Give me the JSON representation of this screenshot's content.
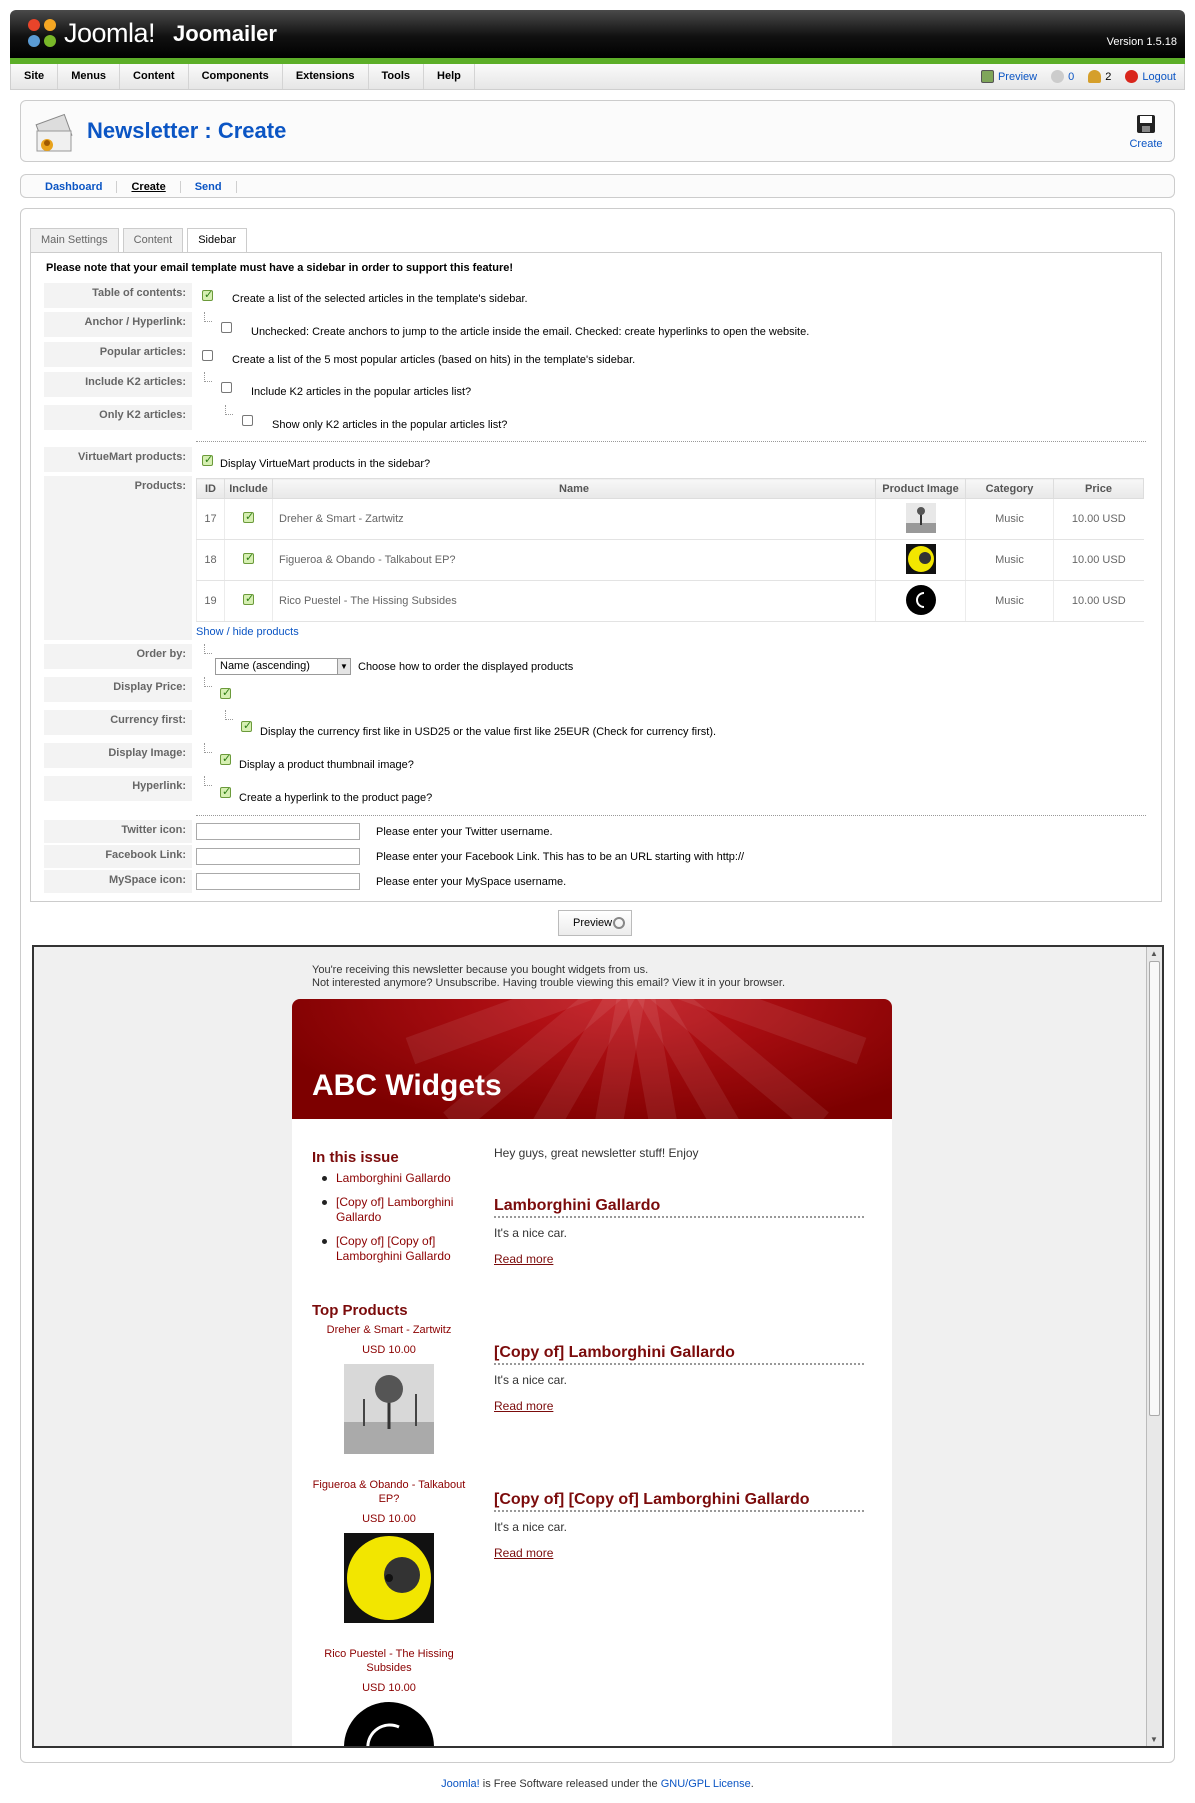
{
  "header": {
    "logo_text": "Joomla!",
    "app_title": "Joomailer",
    "version": "Version 1.5.18"
  },
  "menu": {
    "items": [
      "Site",
      "Menus",
      "Content",
      "Components",
      "Extensions",
      "Tools",
      "Help"
    ],
    "preview": "Preview",
    "messages_count": "0",
    "users_count": "2",
    "logout": "Logout"
  },
  "page": {
    "title": "Newsletter : Create",
    "create_label": "Create"
  },
  "submenu": [
    "Dashboard",
    "Create",
    "Send"
  ],
  "tabs": [
    "Main Settings",
    "Content",
    "Sidebar"
  ],
  "sidebar_form": {
    "notice": "Please note that your email template must have a sidebar in order to support this feature!",
    "toc_label": "Table of contents:",
    "toc_text": "Create a list of the selected articles in the template's sidebar.",
    "anchor_label": "Anchor / Hyperlink:",
    "anchor_text": "Unchecked: Create anchors to jump to the article inside the email. Checked: create hyperlinks to open the website.",
    "popular_label": "Popular articles:",
    "popular_text": "Create a list of the 5 most popular articles (based on hits) in the template's sidebar.",
    "k2_label": "Include K2 articles:",
    "k2_text": "Include K2 articles in the popular articles list?",
    "onlyk2_label": "Only K2 articles:",
    "onlyk2_text": "Show only K2 articles in the popular articles list?",
    "vm_label": "VirtueMart products:",
    "vm_text": "Display VirtueMart products in the sidebar?",
    "products_label": "Products:",
    "show_hide": "Show / hide products",
    "order_label": "Order by:",
    "order_value": "Name (ascending)",
    "order_text": "Choose how to order the displayed products",
    "price_label": "Display Price:",
    "currency_label": "Currency first:",
    "currency_text": "Display the currency first like in USD25 or the value first like 25EUR (Check for currency first).",
    "image_label": "Display Image:",
    "image_text": "Display a product thumbnail image?",
    "hyperlink_label": "Hyperlink:",
    "hyperlink_text": "Create a hyperlink to the product page?",
    "twitter_label": "Twitter icon:",
    "twitter_text": "Please enter your Twitter username.",
    "facebook_label": "Facebook Link:",
    "facebook_text": "Please enter your Facebook Link. This has to be an URL starting with http://",
    "myspace_label": "MySpace icon:",
    "myspace_text": "Please enter your MySpace username."
  },
  "products_table": {
    "headers": [
      "ID",
      "Include",
      "Name",
      "Product Image",
      "Category",
      "Price"
    ],
    "rows": [
      {
        "id": "17",
        "name": "Dreher & Smart - Zartwitz",
        "category": "Music",
        "price": "10.00 USD"
      },
      {
        "id": "18",
        "name": "Figueroa & Obando - Talkabout EP?",
        "category": "Music",
        "price": "10.00 USD"
      },
      {
        "id": "19",
        "name": "Rico Puestel - The Hissing Subsides",
        "category": "Music",
        "price": "10.00 USD"
      }
    ]
  },
  "preview_button": "Preview",
  "newsletter": {
    "top_line1": "You're receiving this newsletter because you bought widgets from us.",
    "top_line2": "Not interested anymore? Unsubscribe. Having trouble viewing this email? View it in your browser.",
    "brand": "ABC Widgets",
    "in_this_issue": "In this issue",
    "issue_items": [
      "Lamborghini Gallardo",
      "[Copy of] Lamborghini Gallardo",
      "[Copy of] [Copy of] Lamborghini Gallardo"
    ],
    "top_products": "Top Products",
    "products": [
      {
        "name": "Dreher & Smart - Zartwitz",
        "price": "USD 10.00"
      },
      {
        "name": "Figueroa & Obando - Talkabout EP?",
        "price": "USD 10.00"
      },
      {
        "name": "Rico Puestel - The Hissing Subsides",
        "price": "USD 10.00"
      }
    ],
    "intro": "Hey guys, great newsletter stuff! Enjoy",
    "articles": [
      {
        "title": "Lamborghini Gallardo",
        "body": "It's a nice car.",
        "read_more": "Read more"
      },
      {
        "title": "[Copy of] Lamborghini Gallardo",
        "body": "It's a nice car.",
        "read_more": "Read more"
      },
      {
        "title": "[Copy of] [Copy of] Lamborghini Gallardo",
        "body": "It's a nice car.",
        "read_more": "Read more"
      }
    ]
  },
  "footer": {
    "joomla_link": "Joomla!",
    "middle": " is Free Software released under the ",
    "license_link": "GNU/GPL License",
    "end": "."
  },
  "colors": {
    "link_blue": "#0b55c4",
    "green_bar": "#5cae28",
    "newsletter_red": "#7b0b0b"
  }
}
